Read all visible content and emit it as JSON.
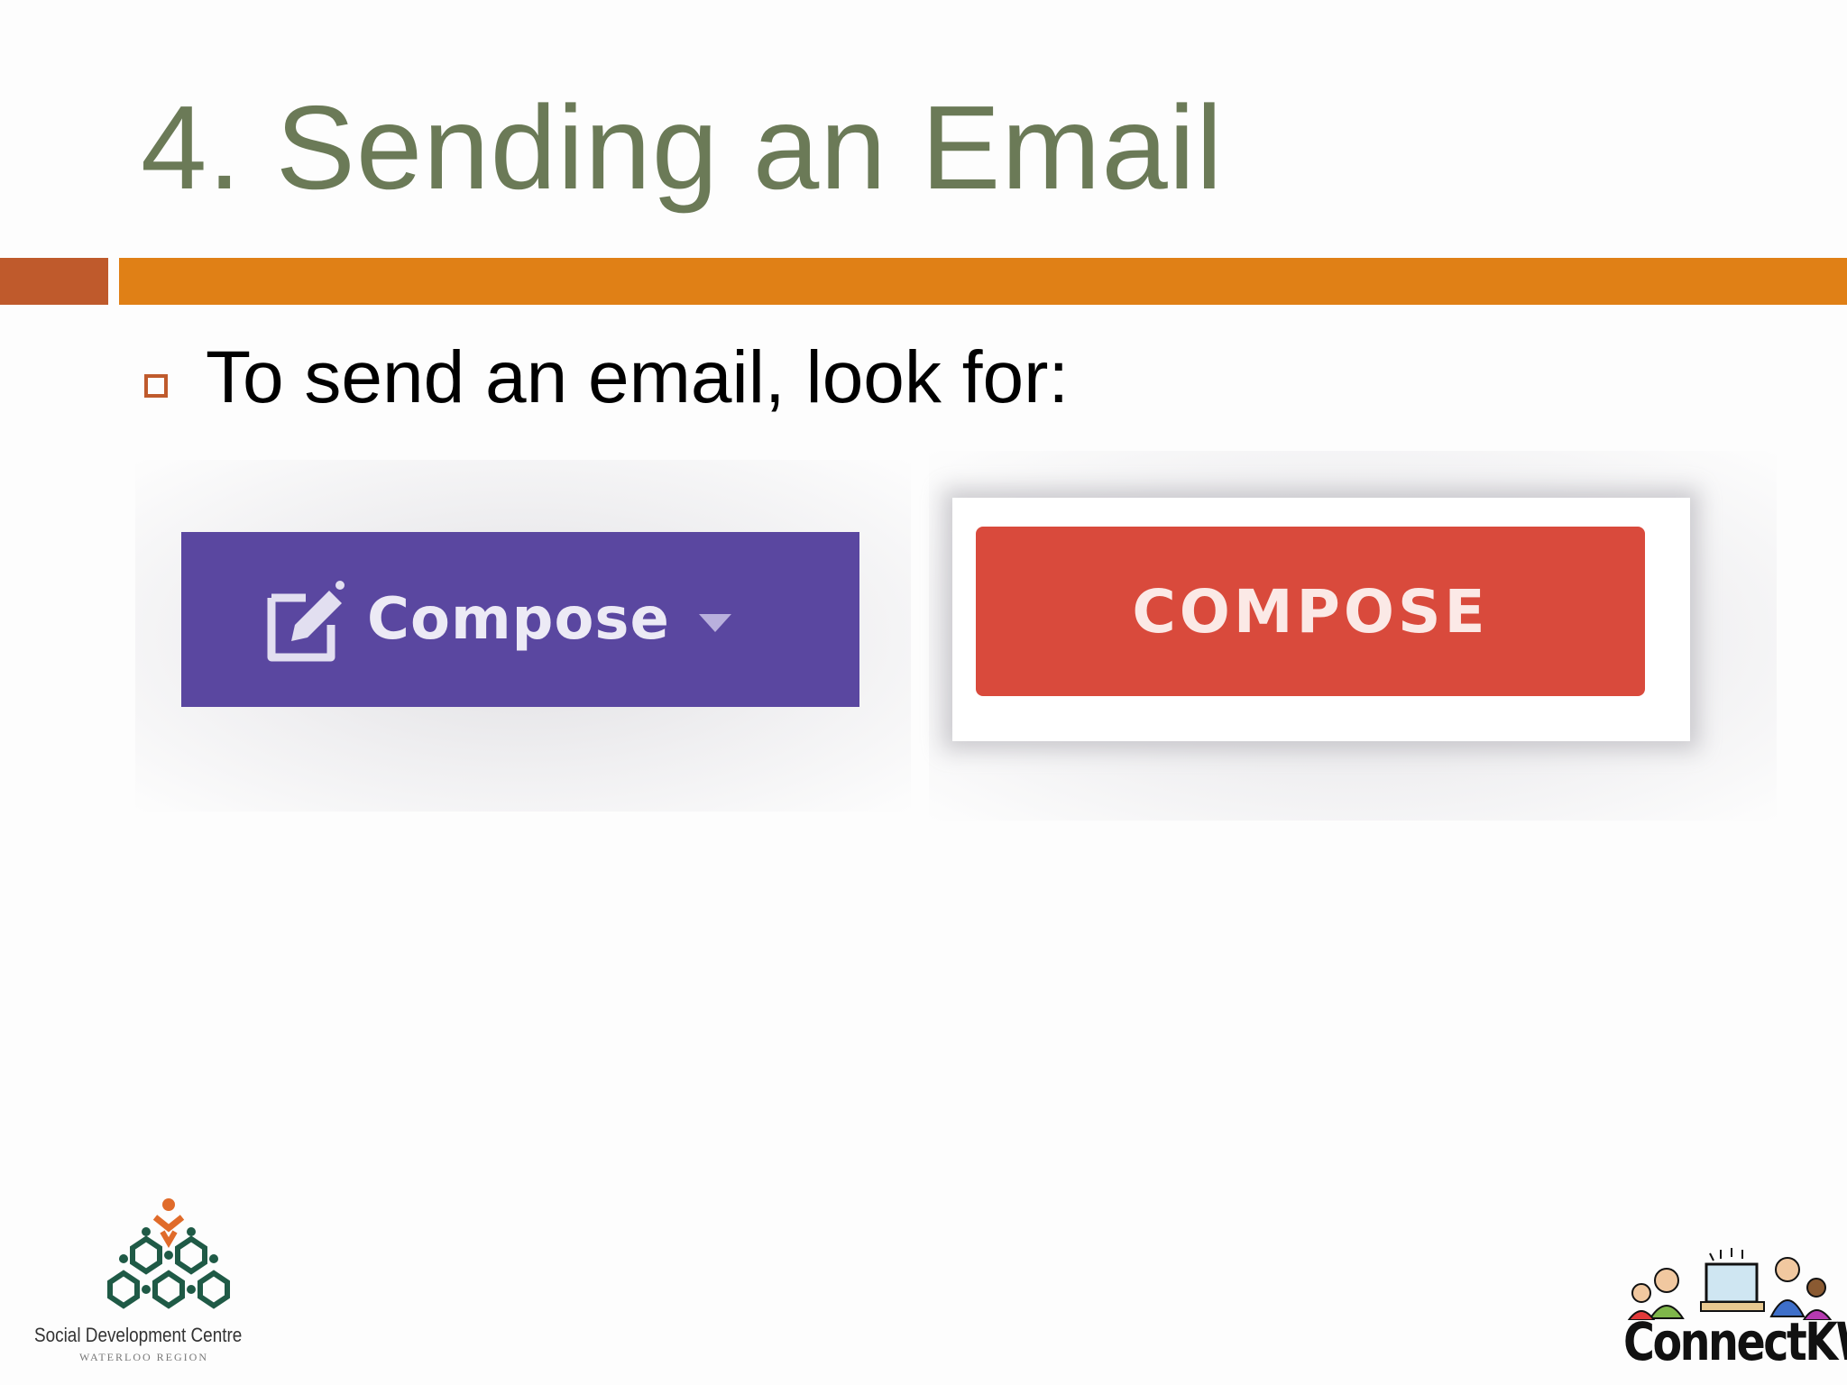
{
  "slide": {
    "title": "4. Sending an Email",
    "bullet_text": "To send an email, look for:"
  },
  "buttons": {
    "yahoo_compose_label": "Compose",
    "gmail_compose_label": "COMPOSE"
  },
  "logos": {
    "sdc_name": "Social Development Centre",
    "sdc_region": "WATERLOO REGION",
    "ckw_name": "ConnectKW"
  },
  "colors": {
    "title": "#6b7a57",
    "accent_bar": "#e08016",
    "accent_dark": "#bf5a2c",
    "yahoo_purple": "#5a47a0",
    "gmail_red": "#d94a3c"
  },
  "icons": {
    "bullet": "square-bullet-icon",
    "compose_edit": "edit-pencil-icon",
    "dropdown": "caret-down-icon"
  }
}
